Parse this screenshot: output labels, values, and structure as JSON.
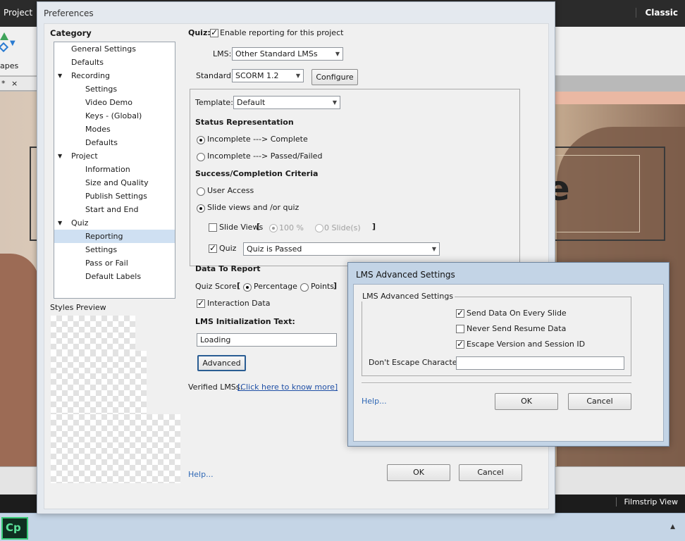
{
  "app": {
    "project_menu": "Project",
    "workspace": "Classic",
    "shapes_label": "apes",
    "doc_tab_star": "*",
    "doc_tab_close": "×",
    "slide_text": "e",
    "filmstrip_label": "Filmstrip View",
    "taskbar_app": "Cp"
  },
  "prefs": {
    "title": "Preferences",
    "category_label": "Category",
    "tree": [
      {
        "label": "General Settings",
        "level": 1
      },
      {
        "label": "Defaults",
        "level": 1
      },
      {
        "label": "Recording",
        "level": 1,
        "expanded": true
      },
      {
        "label": "Settings",
        "level": 2
      },
      {
        "label": "Video Demo",
        "level": 2
      },
      {
        "label": "Keys - (Global)",
        "level": 2
      },
      {
        "label": "Modes",
        "level": 2
      },
      {
        "label": "Defaults",
        "level": 2
      },
      {
        "label": "Project",
        "level": 1,
        "expanded": true
      },
      {
        "label": "Information",
        "level": 2
      },
      {
        "label": "Size and Quality",
        "level": 2
      },
      {
        "label": "Publish Settings",
        "level": 2
      },
      {
        "label": "Start and End",
        "level": 2
      },
      {
        "label": "Quiz",
        "level": 1,
        "expanded": true
      },
      {
        "label": "Reporting",
        "level": 2,
        "selected": true
      },
      {
        "label": "Settings",
        "level": 2
      },
      {
        "label": "Pass or Fail",
        "level": 2
      },
      {
        "label": "Default Labels",
        "level": 2
      }
    ],
    "styles_preview_label": "Styles Preview",
    "quiz_label": "Quiz:",
    "enable_reporting_label": "Enable reporting for this project",
    "enable_reporting_checked": true,
    "lms_label": "LMS:",
    "lms_value": "Other Standard LMSs",
    "standard_label": "Standard:",
    "standard_value": "SCORM 1.2",
    "configure_button": "Configure",
    "template_label": "Template:",
    "template_value": "Default",
    "status_heading": "Status Representation",
    "status_option1": "Incomplete ---> Complete",
    "status_option2": "Incomplete ---> Passed/Failed",
    "status_selected": 1,
    "criteria_heading": "Success/Completion Criteria",
    "criteria_option1": "User Access",
    "criteria_option2": "Slide views and /or quiz",
    "criteria_selected": 2,
    "slide_views_label": "Slide Views",
    "slide_views_checked": false,
    "bracket_open": "[",
    "bracket_close": "]",
    "slide_percent": "100 %",
    "slide_count": "0 Slide(s)",
    "quiz_check_label": "Quiz",
    "quiz_checked": true,
    "quiz_condition": "Quiz is Passed",
    "data_heading": "Data To Report",
    "quiz_score_label": "Quiz Score",
    "percentage_label": "Percentage",
    "points_label": "Points",
    "score_selected": "percentage",
    "interaction_label": "Interaction Data",
    "interaction_checked": true,
    "init_text_heading": "LMS Initialization Text:",
    "init_text_value": "Loading",
    "advanced_button": "Advanced",
    "verified_label": "Verified LMSs:",
    "verified_link": "[Click here to know more]",
    "help_link": "Help...",
    "ok_button": "OK",
    "cancel_button": "Cancel"
  },
  "lms_dialog": {
    "title": "LMS Advanced Settings",
    "group_label": "LMS Advanced Settings",
    "send_data_label": "Send Data On Every Slide",
    "send_data_checked": true,
    "never_resume_label": "Never Send Resume Data",
    "never_resume_checked": false,
    "escape_label": "Escape Version and Session ID",
    "escape_checked": true,
    "dont_escape_label": "Don't Escape Characters:",
    "dont_escape_value": "",
    "help_link": "Help...",
    "ok_button": "OK",
    "cancel_button": "Cancel"
  }
}
